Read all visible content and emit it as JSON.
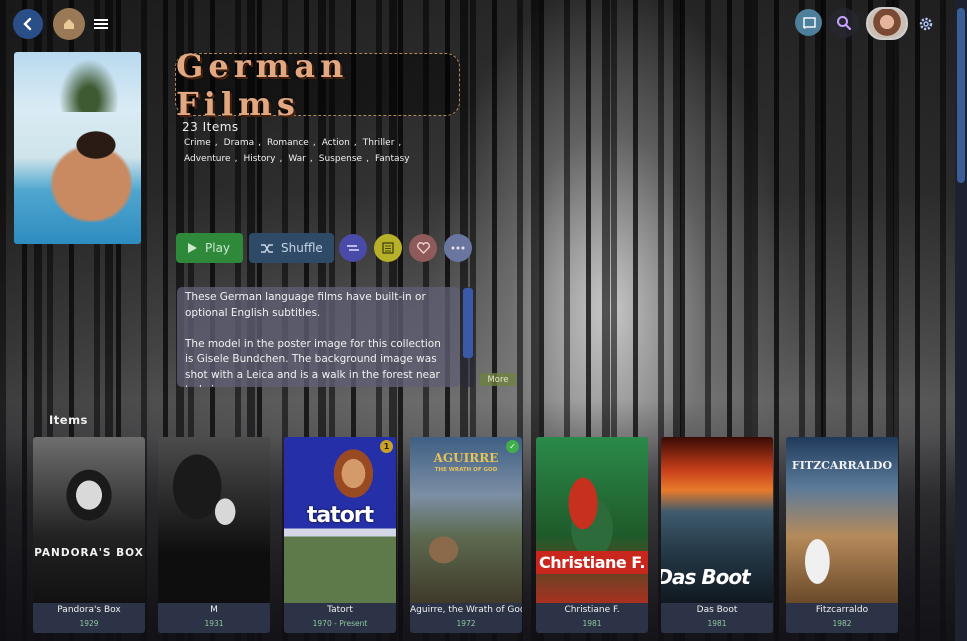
{
  "header": {
    "back_icon": "back-arrow-icon",
    "home_icon": "home-icon",
    "menu_icon": "hamburger-menu-icon",
    "cast_icon": "cast-icon",
    "search_icon": "search-icon",
    "settings_icon": "gear-icon"
  },
  "collection": {
    "title": "German Films",
    "item_count": "23 Items",
    "genres": [
      "Crime",
      "Drama",
      "Romance",
      "Action",
      "Thriller",
      "Adventure",
      "History",
      "War",
      "Suspense",
      "Fantasy"
    ]
  },
  "actions": {
    "play_label": "Play",
    "shuffle_label": "Shuffle",
    "extra_icons": [
      "sort-icon",
      "select-icon",
      "heart-icon",
      "more-icon"
    ]
  },
  "overview": {
    "paragraph1": "These German language films have built-in or optional English subtitles.",
    "paragraph2": "The model in the poster image for this collection is Gisele Bundchen. The background image was shot with a Leica and is a walk in the forest near to Leic...",
    "more_label": "More"
  },
  "section_label": "Items",
  "items": [
    {
      "title": "Pandora's Box",
      "year": "1929",
      "art_text": "PANDORA'S BOX",
      "badge": ""
    },
    {
      "title": "M",
      "year": "1931",
      "art_text": "",
      "badge": ""
    },
    {
      "title": "Tatort",
      "year": "1970 - Present",
      "art_text": "tatort",
      "badge": "1"
    },
    {
      "title": "Aguirre, the Wrath of God",
      "year": "1972",
      "art_text": "AGUIRRE",
      "art_sub": "THE WRATH OF GOD",
      "badge": "✓"
    },
    {
      "title": "Christiane F.",
      "year": "1981",
      "art_text": "Christiane F.",
      "badge": ""
    },
    {
      "title": "Das Boot",
      "year": "1981",
      "art_text": "Das Boot",
      "badge": ""
    },
    {
      "title": "Fitzcarraldo",
      "year": "1982",
      "art_text": "FITZCARRALDO",
      "badge": ""
    }
  ],
  "colors": {
    "accent_blue": "#2a4f88",
    "play_green": "#2e8a3a",
    "year_text": "#8fc7a0"
  }
}
